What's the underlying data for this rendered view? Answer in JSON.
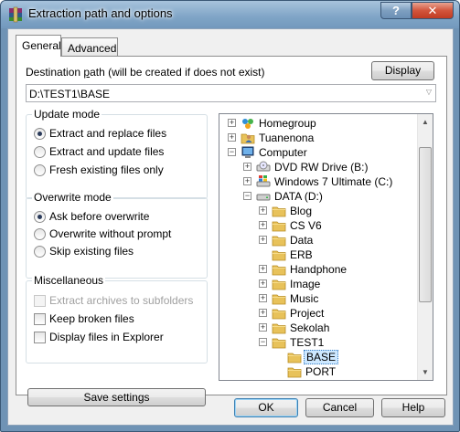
{
  "window": {
    "title": "Extraction path and options",
    "help_label": "?",
    "close_label": "✕"
  },
  "tabs": [
    {
      "label": "General",
      "active": true
    },
    {
      "label": "Advanced",
      "active": false
    }
  ],
  "destination": {
    "label_pre": "Destination ",
    "label_acc": "p",
    "label_post": "ath (will be created if does not exist)",
    "value": "D:\\TEST1\\BASE",
    "display_button": "Display"
  },
  "update_mode": {
    "title": "Update mode",
    "options": [
      {
        "label": "Extract and replace files",
        "checked": true
      },
      {
        "label": "Extract and update files",
        "checked": false
      },
      {
        "label": "Fresh existing files only",
        "checked": false
      }
    ]
  },
  "overwrite_mode": {
    "title": "Overwrite mode",
    "options": [
      {
        "label": "Ask before overwrite",
        "checked": true
      },
      {
        "label": "Overwrite without prompt",
        "checked": false
      },
      {
        "label": "Skip existing files",
        "checked": false
      }
    ]
  },
  "misc": {
    "title": "Miscellaneous",
    "options": [
      {
        "label": "Extract archives to subfolders",
        "checked": false,
        "disabled": true
      },
      {
        "label": "Keep broken files",
        "checked": false,
        "disabled": false
      },
      {
        "label": "Display files in Explorer",
        "checked": false,
        "disabled": false
      }
    ]
  },
  "save_settings_button": "Save settings",
  "tree": {
    "nodes": [
      {
        "label": "Homegroup",
        "icon": "homegroup-icon",
        "level": 0,
        "expander": "+"
      },
      {
        "label": "Tuanenona",
        "icon": "user-folder-icon",
        "level": 0,
        "expander": "+"
      },
      {
        "label": "Computer",
        "icon": "computer-icon",
        "level": 0,
        "expander": "−"
      },
      {
        "label": "DVD RW Drive (B:)",
        "icon": "dvd-drive-icon",
        "level": 1,
        "expander": "+"
      },
      {
        "label": "Windows 7 Ultimate (C:)",
        "icon": "windows-drive-icon",
        "level": 1,
        "expander": "+"
      },
      {
        "label": "DATA (D:)",
        "icon": "hard-drive-icon",
        "level": 1,
        "expander": "−"
      },
      {
        "label": "Blog",
        "icon": "folder-icon",
        "level": 2,
        "expander": "+"
      },
      {
        "label": "CS V6",
        "icon": "folder-icon",
        "level": 2,
        "expander": "+"
      },
      {
        "label": "Data",
        "icon": "folder-icon",
        "level": 2,
        "expander": "+"
      },
      {
        "label": "ERB",
        "icon": "folder-icon",
        "level": 2,
        "expander": ""
      },
      {
        "label": "Handphone",
        "icon": "folder-icon",
        "level": 2,
        "expander": "+"
      },
      {
        "label": "Image",
        "icon": "folder-icon",
        "level": 2,
        "expander": "+"
      },
      {
        "label": "Music",
        "icon": "folder-icon",
        "level": 2,
        "expander": "+"
      },
      {
        "label": "Project",
        "icon": "folder-icon",
        "level": 2,
        "expander": "+"
      },
      {
        "label": "Sekolah",
        "icon": "folder-icon",
        "level": 2,
        "expander": "+"
      },
      {
        "label": "TEST1",
        "icon": "folder-icon",
        "level": 2,
        "expander": "−"
      },
      {
        "label": "BASE",
        "icon": "folder-icon",
        "level": 3,
        "expander": "",
        "selected": true
      },
      {
        "label": "PORT",
        "icon": "folder-icon",
        "level": 3,
        "expander": ""
      }
    ]
  },
  "footer": {
    "ok": "OK",
    "cancel": "Cancel",
    "help": "Help"
  },
  "colors": {
    "titlebar": "#7fa4c6",
    "close": "#c03b22",
    "folder": "#e8c25a",
    "selection": "#cde8ff"
  }
}
